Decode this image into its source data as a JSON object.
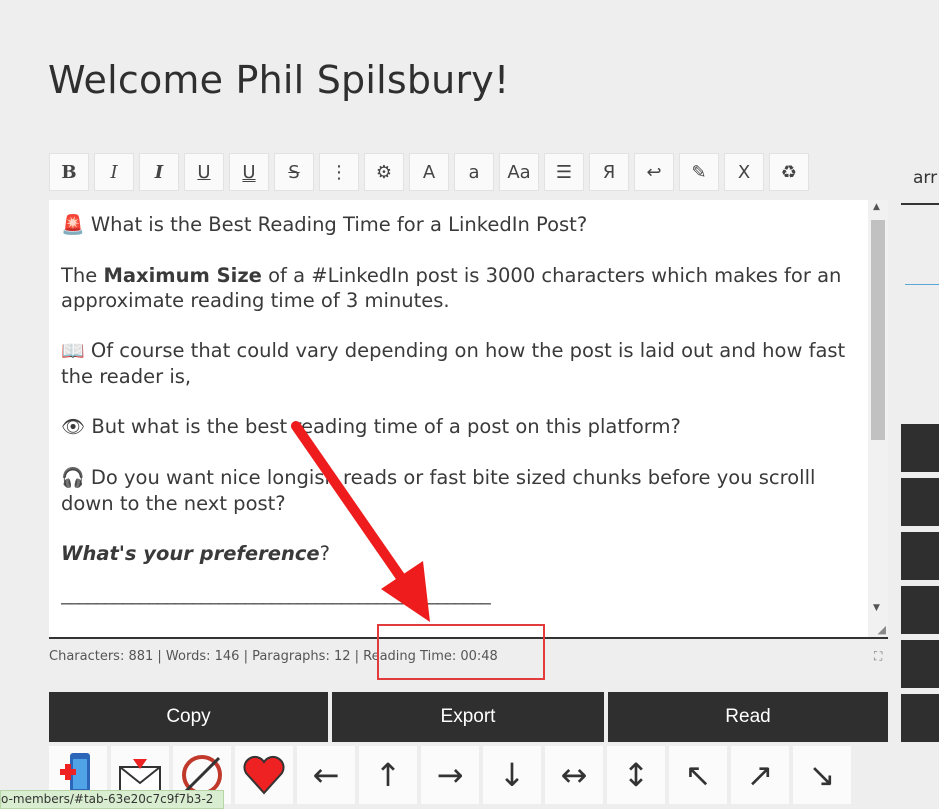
{
  "page": {
    "title": "Welcome Phil Spilsbury!"
  },
  "toolbar": {
    "buttons": [
      "B",
      "I",
      "I",
      "U",
      "U",
      "S",
      "⋮",
      "⚙",
      "A",
      "a",
      "Aa",
      "☰",
      "Я",
      "↩",
      "✎",
      "X",
      "♻"
    ]
  },
  "editor": {
    "p1_text": "What is the Best Reading Time for a LinkedIn Post?",
    "p2_pre": "The ",
    "p2_bold": "Maximum Size",
    "p2_post": " of a #LinkedIn post is 3000 characters which makes for an approximate reading time of 3 minutes.",
    "p3_text": "Of course that could vary depending on how the post is laid out and how fast the reader is,",
    "p4_text": "But what is the best reading time of a post on this platform?",
    "p5_text": "Do you want nice longish reads or fast bite sized chunks before you scrolll down to the next post?",
    "p6_bolditalic": "What's your preference",
    "p6_tail": "?",
    "separator": "_________________________________________________"
  },
  "stats": {
    "text": "Characters: 881 | Words: 146 | Paragraphs: 12 | Reading Time: 00:48"
  },
  "actions": {
    "copy": "Copy",
    "export": "Export",
    "read": "Read"
  },
  "icon_row": {
    "arrows": [
      "←",
      "↑",
      "→",
      "↓",
      "↔",
      "↕",
      "↖",
      "↗",
      "↘"
    ]
  },
  "side": {
    "tab_label": "arr"
  },
  "status_bar": {
    "url": "o-members/#tab-63e20c7c9f7b3-2"
  },
  "colors": {
    "highlight": "#e23b3b",
    "dark": "#2f2f2f"
  }
}
